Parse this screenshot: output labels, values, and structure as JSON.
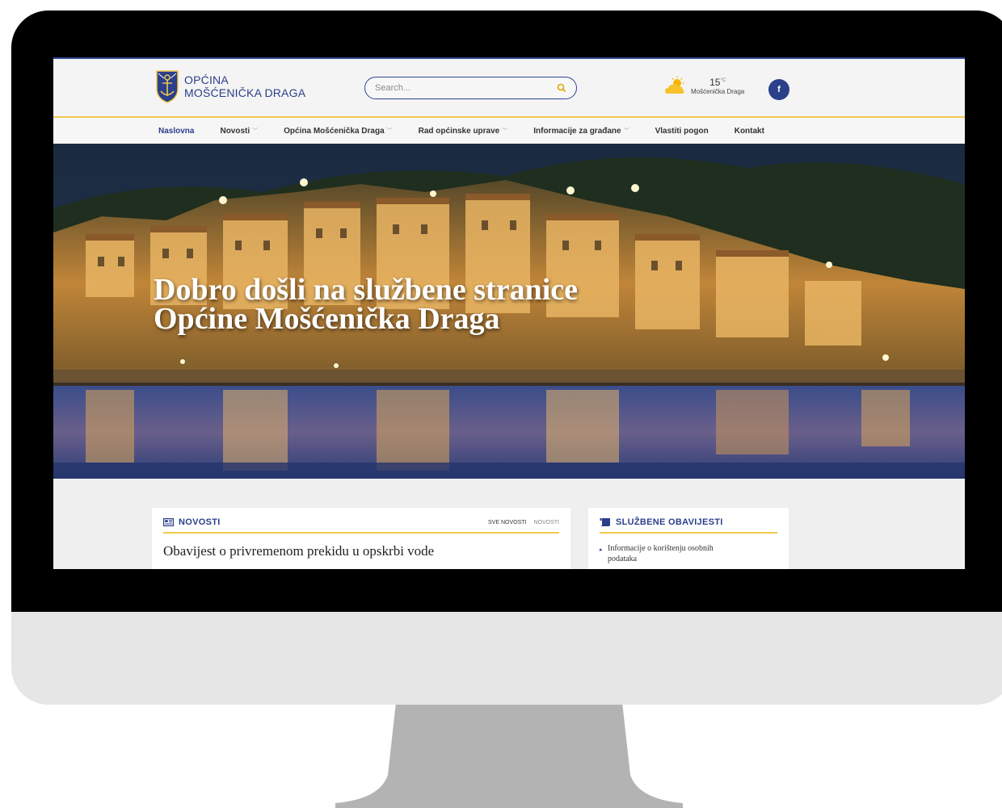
{
  "header": {
    "logo_line1": "OPĆINA",
    "logo_line2": "MOŠĆENIČKA DRAGA",
    "search_placeholder": "Search...",
    "weather": {
      "temp": "15",
      "unit": "°C",
      "place": "Mošćenička Draga",
      "icon": "partly-cloudy-icon"
    },
    "social": {
      "label": "f",
      "icon": "facebook-icon"
    }
  },
  "nav": {
    "items": [
      {
        "label": "Naslovna",
        "dropdown": false,
        "active": true
      },
      {
        "label": "Novosti",
        "dropdown": true
      },
      {
        "label": "Općina Mošćenička Draga",
        "dropdown": true
      },
      {
        "label": "Rad općinske uprave",
        "dropdown": true
      },
      {
        "label": "Informacije za građane",
        "dropdown": true
      },
      {
        "label": "Vlastiti pogon",
        "dropdown": false
      },
      {
        "label": "Kontakt",
        "dropdown": false
      }
    ]
  },
  "hero": {
    "title_line1": "Dobro došli na službene stranice",
    "title_line2": "Općine Mošćenička Draga"
  },
  "news": {
    "title": "NOVOSTI",
    "link_all": "SVE NOVOSTI",
    "link_news": "NOVOSTI",
    "headline": "Obavijest o privremenom prekidu u opskrbi vode"
  },
  "notices": {
    "title": "SLUŽBENE OBAVIJESTI",
    "item1_line1": "Informacije o korištenju osobnih",
    "item1_line2": "podataka"
  },
  "colors": {
    "brand": "#2b3f8a",
    "accent": "#f2c94c",
    "bezel": "#000000",
    "monitor": "#e6e6e6",
    "stand": "#b3b3b3"
  }
}
